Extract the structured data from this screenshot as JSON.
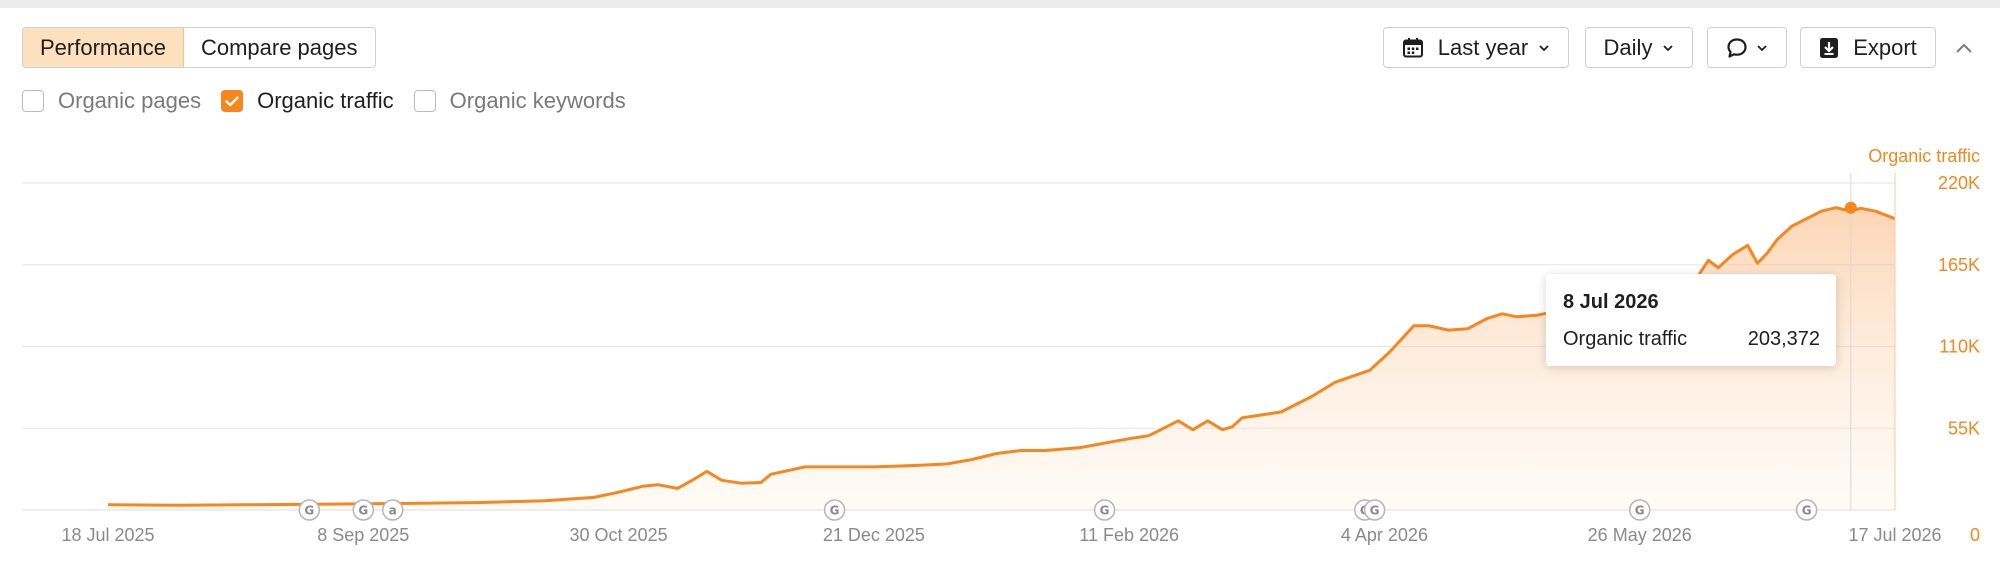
{
  "tabs": [
    {
      "label": "Performance",
      "active": true
    },
    {
      "label": "Compare pages",
      "active": false
    }
  ],
  "checkboxes": [
    {
      "label": "Organic pages",
      "checked": false
    },
    {
      "label": "Organic traffic",
      "checked": true
    },
    {
      "label": "Organic keywords",
      "checked": false
    }
  ],
  "toolbar": {
    "date_range_label": "Last year",
    "date_range_icon": "calendar-icon",
    "interval_label": "Daily",
    "annotations_icon": "comment-icon",
    "export_label": "Export",
    "export_icon": "download-icon",
    "collapse_icon": "chevron-up-icon"
  },
  "colors": {
    "accent": "#f7861c",
    "active_tab_bg": "#fde0bd",
    "grid": "#e6e6e6",
    "muted": "#8a8a8a"
  },
  "chart_data": {
    "type": "area",
    "series_title": "Organic traffic",
    "y_axis_position": "right",
    "ylim": [
      0,
      220000
    ],
    "y_ticks": [
      0,
      55000,
      110000,
      165000,
      220000
    ],
    "y_tick_labels": [
      "0",
      "55K",
      "110K",
      "165K",
      "220K"
    ],
    "x_tick_labels": [
      "18 Jul 2025",
      "8 Sep 2025",
      "30 Oct 2025",
      "21 Dec 2025",
      "11 Feb 2026",
      "4 Apr 2026",
      "26 May 2026",
      "17 Jul 2026"
    ],
    "x_tick_dates": [
      "2025-07-18",
      "2025-09-08",
      "2025-10-30",
      "2025-12-21",
      "2026-02-11",
      "2026-04-04",
      "2026-05-26",
      "2026-07-17"
    ],
    "grid": true,
    "series": [
      {
        "name": "Organic traffic",
        "x": [
          "2025-07-18",
          "2025-08-01",
          "2025-08-15",
          "2025-09-01",
          "2025-09-15",
          "2025-10-01",
          "2025-10-15",
          "2025-10-25",
          "2025-10-30",
          "2025-11-04",
          "2025-11-07",
          "2025-11-11",
          "2025-11-14",
          "2025-11-17",
          "2025-11-20",
          "2025-11-24",
          "2025-11-28",
          "2025-11-30",
          "2025-12-07",
          "2025-12-14",
          "2025-12-21",
          "2025-12-30",
          "2026-01-05",
          "2026-01-10",
          "2026-01-15",
          "2026-01-20",
          "2026-01-25",
          "2026-02-01",
          "2026-02-11",
          "2026-02-15",
          "2026-02-18",
          "2026-02-21",
          "2026-02-24",
          "2026-02-27",
          "2026-03-02",
          "2026-03-04",
          "2026-03-06",
          "2026-03-10",
          "2026-03-14",
          "2026-03-20",
          "2026-03-25",
          "2026-04-01",
          "2026-04-05",
          "2026-04-10",
          "2026-04-13",
          "2026-04-17",
          "2026-04-21",
          "2026-04-25",
          "2026-04-28",
          "2026-05-01",
          "2026-05-05",
          "2026-05-08",
          "2026-05-12",
          "2026-05-16",
          "2026-05-20",
          "2026-05-26",
          "2026-06-01",
          "2026-06-07",
          "2026-06-09",
          "2026-06-11",
          "2026-06-14",
          "2026-06-17",
          "2026-06-19",
          "2026-06-21",
          "2026-06-23",
          "2026-06-26",
          "2026-06-29",
          "2026-07-02",
          "2026-07-05",
          "2026-07-08",
          "2026-07-10",
          "2026-07-13",
          "2026-07-17"
        ],
        "y": [
          3500,
          3200,
          3500,
          4000,
          4400,
          5000,
          6200,
          8500,
          12000,
          16000,
          17000,
          14500,
          20000,
          26000,
          20000,
          18000,
          18500,
          24000,
          29000,
          29000,
          29000,
          30000,
          31000,
          34000,
          38000,
          40000,
          40000,
          42000,
          48000,
          50000,
          55000,
          60000,
          54000,
          60000,
          54000,
          56000,
          62000,
          64000,
          66000,
          76000,
          86000,
          94000,
          106000,
          124000,
          124000,
          121000,
          122000,
          129000,
          132000,
          130000,
          131000,
          133000,
          136000,
          138000,
          140000,
          145000,
          148000,
          158000,
          168000,
          163000,
          172000,
          178000,
          166000,
          173000,
          182000,
          191000,
          196000,
          201000,
          203372,
          201000,
          203000,
          201000,
          196000
        ]
      }
    ],
    "event_markers": [
      {
        "date": "2025-08-28",
        "label": "G"
      },
      {
        "date": "2025-09-08",
        "label": "G"
      },
      {
        "date": "2025-09-14",
        "label": "a"
      },
      {
        "date": "2025-12-13",
        "label": "G"
      },
      {
        "date": "2026-02-06",
        "label": "G"
      },
      {
        "date": "2026-03-31",
        "label": "G"
      },
      {
        "date": "2026-04-02",
        "label": "G"
      },
      {
        "date": "2026-05-26",
        "label": "G"
      },
      {
        "date": "2026-06-29",
        "label": "G"
      }
    ],
    "highlight": {
      "date": "2026-07-08",
      "value": 203372
    }
  },
  "tooltip": {
    "date": "8 Jul 2026",
    "series_label": "Organic traffic",
    "value": "203,372"
  }
}
